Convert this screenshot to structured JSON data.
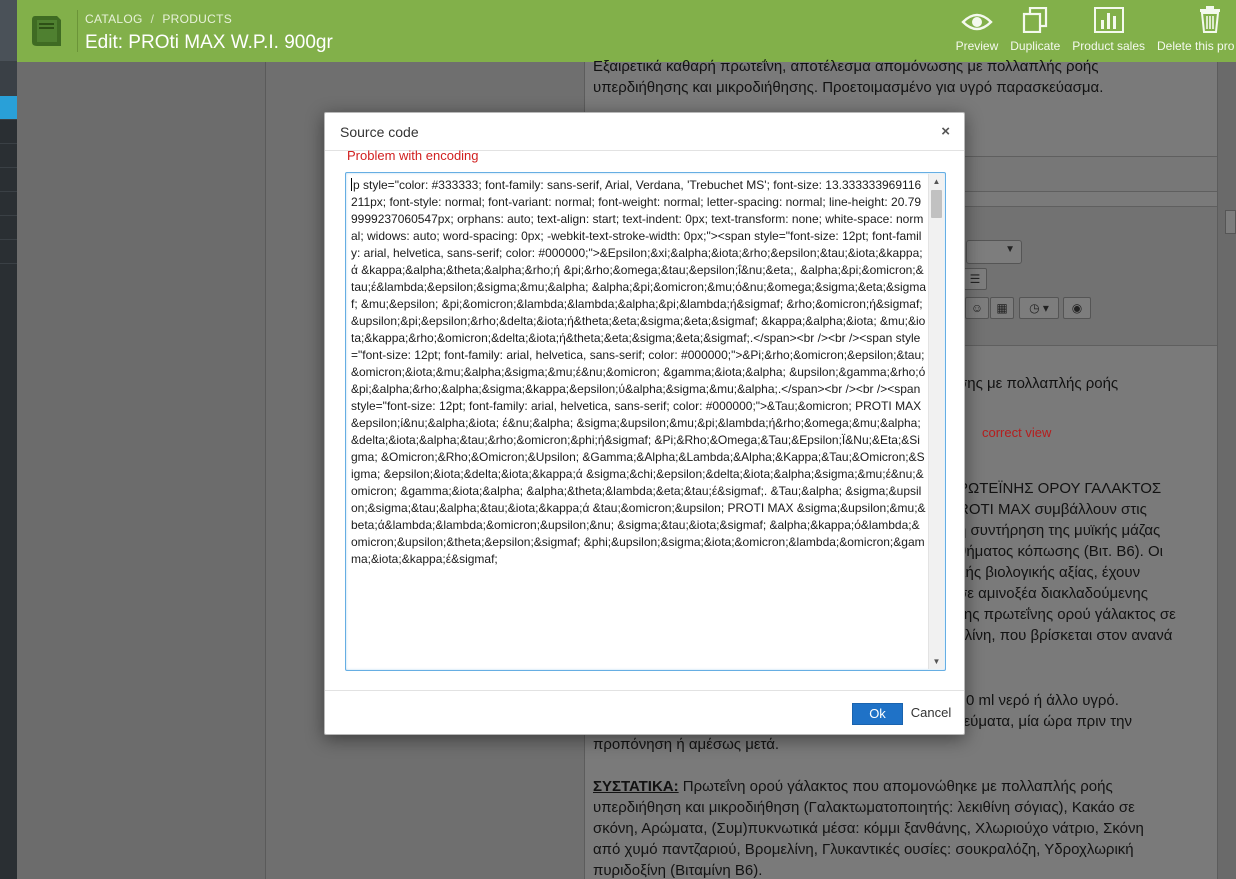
{
  "header": {
    "breadcrumb": [
      "CATALOG",
      "PRODUCTS"
    ],
    "title": "Edit: PROti MAX W.P.I. 900gr",
    "actions": {
      "preview": "Preview",
      "duplicate": "Duplicate",
      "product_sales": "Product sales",
      "delete": "Delete this pro"
    }
  },
  "background": {
    "intro": [
      "Εξαιρετικά καθαρή πρωτεΐνη, αποτέλεσμα απομόνωσης με πολλαπλής ροής",
      "υπερδιήθησης και μικροδιήθησης. Προετοιμασμένο για υγρό παρασκεύασμα."
    ],
    "snippet_1": "σης με πολλαπλής ροής",
    "correct_view": "correct view",
    "column": [
      "ΡΩΤΕΪΝΗΣ ΟΡΟΥ ΓΑΛΑΚΤΟΣ",
      "ROTI MAX συμβάλλουν στις",
      "ή συντήρηση της μυϊκής μάζας",
      "θήματος κόπωσης (Βιτ. Β6). Οι",
      "λής βιολογικής αξίας, έχουν",
      "σε αμινοξέα διακλαδούμενης",
      "της πρωτεΐνης ορού γάλακτος σε",
      "ελίνη, που βρίσκεται στον ανανά"
    ],
    "dosage": [
      "0 ml νερό ή άλλο υγρό.",
      "γεύματα, μία ώρα πριν την",
      "προπόνηση ή αμέσως μετά."
    ],
    "ingredients_label": "ΣΥΣΤΑΤΙΚΑ:",
    "ingredients": [
      " Πρωτεΐνη ορού γάλακτος που απομονώθηκε με πολλαπλής ροής",
      "υπερδιήθηση και μικροδιήθηση (Γαλακτωματοποιητής: λεκιθίνη σόγιας), Κακάο σε",
      "σκόνη, Αρώματα, (Συμ)πυκνωτικά μέσα: κόμμι ξανθάνης, Χλωριούχο νάτριο, Σκόνη",
      "από χυμό παντζαριού, Βρομελίνη, Γλυκαντικές ουσίες: σουκραλόζη, Υδροχλωρική",
      "πυριδοξίνη (Βιταμίνη Β6)."
    ]
  },
  "modal": {
    "title": "Source code",
    "close": "×",
    "note": "Problem with encoding",
    "code": "p style=\"color: #333333; font-family: sans-serif, Arial, Verdana, 'Trebuchet MS'; font-size: 13.333333969116211px; font-style: normal; font-variant: normal; font-weight: normal; letter-spacing: normal; line-height: 20.799999237060547px; orphans: auto; text-align: start; text-indent: 0px; text-transform: none; white-space: normal; widows: auto; word-spacing: 0px; -webkit-text-stroke-width: 0px;\"><span style=\"font-size: 12pt; font-family: arial, helvetica, sans-serif; color: #000000;\">&Epsilon;&xi;&alpha;&iota;&rho;&epsilon;&tau;&iota;&kappa;ά &kappa;&alpha;&theta;&alpha;&rho;ή &pi;&rho;&omega;&tau;&epsilon;ΐ&nu;&eta;, &alpha;&pi;&omicron;&tau;έ&lambda;&epsilon;&sigma;&mu;&alpha; &alpha;&pi;&omicron;&mu;ό&nu;&omega;&sigma;&eta;&sigmaf; &mu;&epsilon; &pi;&omicron;&lambda;&lambda;&alpha;&pi;&lambda;ή&sigmaf; &rho;&omicron;ή&sigmaf; &upsilon;&pi;&epsilon;&rho;&delta;&iota;ή&theta;&eta;&sigma;&eta;&sigmaf; &kappa;&alpha;&iota; &mu;&iota;&kappa;&rho;&omicron;&delta;&iota;ή&theta;&eta;&sigma;&eta;&sigmaf;.</span><br /><br /><span style=\"font-size: 12pt; font-family: arial, helvetica, sans-serif; color: #000000;\">&Pi;&rho;&omicron;&epsilon;&tau;&omicron;&iota;&mu;&alpha;&sigma;&mu;έ&nu;&omicron; &gamma;&iota;&alpha; &upsilon;&gamma;&rho;ό &pi;&alpha;&rho;&alpha;&sigma;&kappa;&epsilon;ύ&alpha;&sigma;&mu;&alpha;.</span><br /><br /><span style=\"font-size: 12pt; font-family: arial, helvetica, sans-serif; color: #000000;\">&Tau;&omicron; PROTI MAX &epsilon;ί&nu;&alpha;&iota; έ&nu;&alpha; &sigma;&upsilon;&mu;&pi;&lambda;ή&rho;&omega;&mu;&alpha; &delta;&iota;&alpha;&tau;&rho;&omicron;&phi;ή&sigmaf; &Pi;&Rho;&Omega;&Tau;&Epsilon;Ϊ&Nu;&Eta;&Sigma; &Omicron;&Rho;&Omicron;&Upsilon; &Gamma;&Alpha;&Lambda;&Alpha;&Kappa;&Tau;&Omicron;&Sigma; &epsilon;&iota;&delta;&iota;&kappa;ά &sigma;&chi;&epsilon;&delta;&iota;&alpha;&sigma;&mu;έ&nu;&omicron; &gamma;&iota;&alpha; &alpha;&theta;&lambda;&eta;&tau;έ&sigmaf;. &Tau;&alpha; &sigma;&upsilon;&sigma;&tau;&alpha;&tau;&iota;&kappa;ά &tau;&omicron;&upsilon; PROTI MAX &sigma;&upsilon;&mu;&beta;ά&lambda;&lambda;&omicron;&upsilon;&nu; &sigma;&tau;&iota;&sigmaf; &alpha;&kappa;ό&lambda;&omicron;&upsilon;&theta;&epsilon;&sigmaf; &phi;&upsilon;&sigma;&iota;&omicron;&lambda;&omicron;&gamma;&iota;&kappa;έ&sigmaf;",
    "ok": "Ok",
    "cancel": "Cancel"
  },
  "colors": {
    "topbar": "#82b04a",
    "primary_button": "#1f72c7",
    "error_text": "#d12020",
    "focus_border": "#66aee3"
  }
}
